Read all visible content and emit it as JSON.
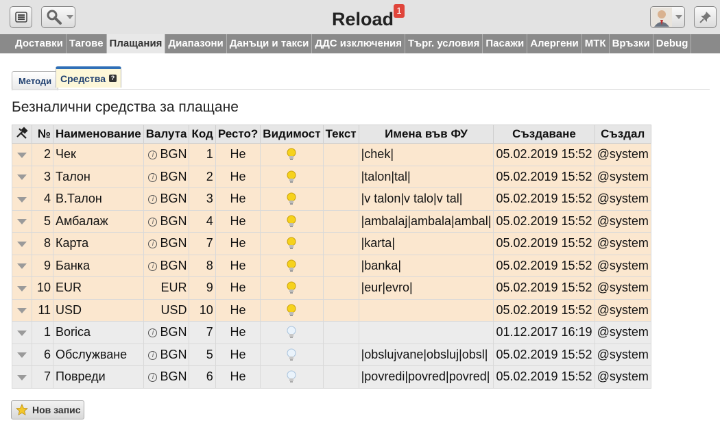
{
  "app": {
    "title": "Reload",
    "notification_count": "1"
  },
  "nav": {
    "tabs": [
      "Доставки",
      "Тагове",
      "Плащания",
      "Диапазони",
      "Данъци и такси",
      "ДДС изключения",
      "Търг. условия",
      "Пасажи",
      "Алергени",
      "МТК",
      "Връзки",
      "Debug"
    ],
    "active": "Плащания"
  },
  "subtabs": {
    "methods": "Методи",
    "means": "Средства"
  },
  "section_title": "Безналични средства за плащане",
  "table": {
    "headers": {
      "no": "№",
      "name": "Наименование",
      "currency": "Валута",
      "code": "Код",
      "change": "Ресто?",
      "visibility": "Видимост",
      "text": "Текст",
      "fu_names": "Имена във ФУ",
      "created": "Създаване",
      "created_by": "Създал"
    },
    "rows": [
      {
        "no": "2",
        "name": "Чек",
        "currency": "BGN",
        "info": true,
        "code": "1",
        "change": "Не",
        "visible": true,
        "text": "",
        "fu": "|chek|",
        "created": "05.02.2019 15:52",
        "by": "@system"
      },
      {
        "no": "3",
        "name": "Талон",
        "currency": "BGN",
        "info": true,
        "code": "2",
        "change": "Не",
        "visible": true,
        "text": "",
        "fu": "|talon|tal|",
        "created": "05.02.2019 15:52",
        "by": "@system"
      },
      {
        "no": "4",
        "name": "В.Талон",
        "currency": "BGN",
        "info": true,
        "code": "3",
        "change": "Не",
        "visible": true,
        "text": "",
        "fu": "|v talon|v talo|v tal|",
        "created": "05.02.2019 15:52",
        "by": "@system"
      },
      {
        "no": "5",
        "name": "Амбалаж",
        "currency": "BGN",
        "info": true,
        "code": "4",
        "change": "Не",
        "visible": true,
        "text": "",
        "fu": "|ambalaj|ambala|ambal|",
        "created": "05.02.2019 15:52",
        "by": "@system"
      },
      {
        "no": "8",
        "name": "Карта",
        "currency": "BGN",
        "info": true,
        "code": "7",
        "change": "Не",
        "visible": true,
        "text": "",
        "fu": "|karta|",
        "created": "05.02.2019 15:52",
        "by": "@system"
      },
      {
        "no": "9",
        "name": "Банка",
        "currency": "BGN",
        "info": true,
        "code": "8",
        "change": "Не",
        "visible": true,
        "text": "",
        "fu": "|banka|",
        "created": "05.02.2019 15:52",
        "by": "@system"
      },
      {
        "no": "10",
        "name": "EUR",
        "currency": "EUR",
        "info": false,
        "code": "9",
        "change": "Не",
        "visible": true,
        "text": "",
        "fu": "|eur|evro|",
        "created": "05.02.2019 15:52",
        "by": "@system"
      },
      {
        "no": "11",
        "name": "USD",
        "currency": "USD",
        "info": false,
        "code": "10",
        "change": "Не",
        "visible": true,
        "text": "",
        "fu": "",
        "created": "05.02.2019 15:52",
        "by": "@system"
      },
      {
        "no": "1",
        "name": "Borica",
        "currency": "BGN",
        "info": true,
        "code": "7",
        "change": "Не",
        "visible": false,
        "text": "",
        "fu": "",
        "created": "01.12.2017 16:19",
        "by": "@system"
      },
      {
        "no": "6",
        "name": "Обслужване",
        "currency": "BGN",
        "info": true,
        "code": "5",
        "change": "Не",
        "visible": false,
        "text": "",
        "fu": "|obslujvane|obsluj|obsl|",
        "created": "05.02.2019 15:52",
        "by": "@system"
      },
      {
        "no": "7",
        "name": "Повреди",
        "currency": "BGN",
        "info": true,
        "code": "6",
        "change": "Не",
        "visible": false,
        "text": "",
        "fu": "|povredi|povred|povred|",
        "created": "05.02.2019 15:52",
        "by": "@system"
      }
    ]
  },
  "new_record_label": "Нов запис",
  "colors": {
    "active_row": "#fbe7cf",
    "inactive_row": "#ececec",
    "nav_bg": "#8a8a8a",
    "badge": "#e0453b",
    "tab_accent": "#2f6fb7"
  }
}
